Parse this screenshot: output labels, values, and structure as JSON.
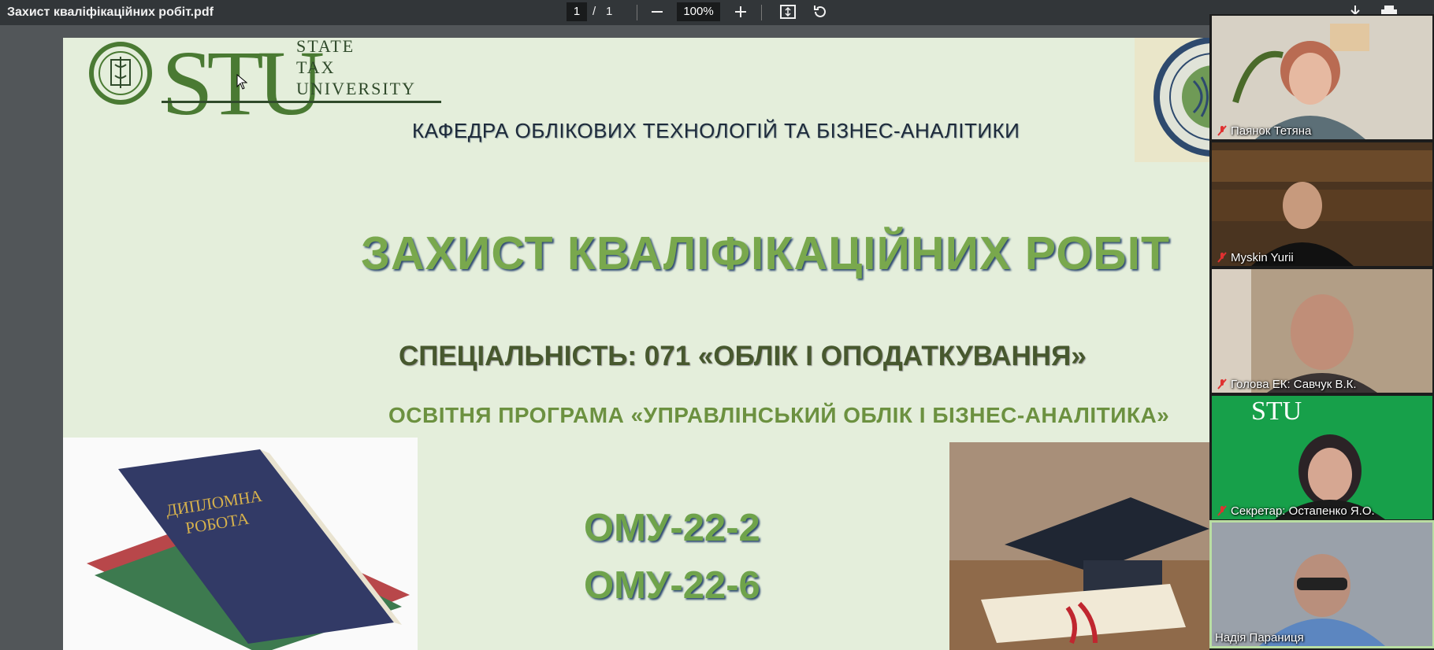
{
  "toolbar": {
    "title": "Захист кваліфікаційних робіт.pdf",
    "page_current": "1",
    "page_separator": "/",
    "page_total": "1",
    "zoom": "100%"
  },
  "slide": {
    "logo_letters": "STU",
    "logo_line1": "STATE",
    "logo_line2": "TAX",
    "logo_line3": "UNIVERSITY",
    "department": "КАФЕДРА ОБЛІКОВИХ ТЕХНОЛОГІЙ ТА БІЗНЕС-АНАЛІТИКИ",
    "title": "ЗАХИСТ КВАЛІФІКАЦІЙНИХ РОБІТ",
    "specialty": "СПЕЦІАЛЬНІСТЬ: 071 «ОБЛІК І ОПОДАТКУВАННЯ»",
    "program": "ОСВІТНЯ ПРОГРАМА «УПРАВЛІНСЬКИЙ ОБЛІК І БІЗНЕС-АНАЛІТИКА»",
    "groups": [
      "ОМУ-22-2",
      "ОМУ-22-6"
    ],
    "book_text_line1": "ДИПЛОМНА",
    "book_text_line2": "РОБОТА"
  },
  "participants": [
    {
      "name": "Паянок Тетяна",
      "muted": true
    },
    {
      "name": "Myskin Yurii",
      "muted": true
    },
    {
      "name": "Голова ЕК: Савчук В.К.",
      "muted": true
    },
    {
      "name": "Секретар: Остапенко Я.О.",
      "muted": true
    },
    {
      "name": "Надія Параниця",
      "muted": false
    }
  ],
  "colors": {
    "toolbar": "#323639",
    "viewer_bg": "#525659",
    "slide_bg": "#e4eedb",
    "title_green": "#79a84d",
    "active_speaker": "#b9dea2"
  }
}
